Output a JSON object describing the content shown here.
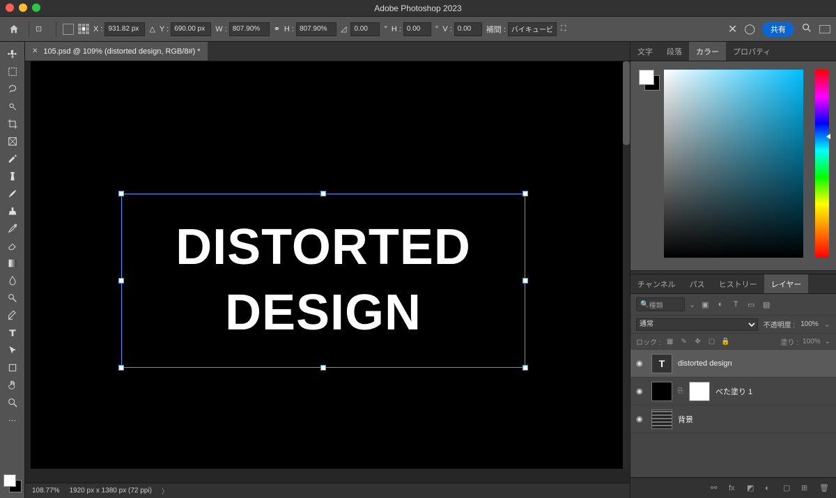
{
  "app_title": "Adobe Photoshop 2023",
  "options": {
    "x_label": "X :",
    "x_value": "931.82 px",
    "y_label": "Y :",
    "y_value": "690.00 px",
    "w_label": "W :",
    "w_value": "807.90%",
    "h_label": "H :",
    "h_value": "807.90%",
    "angle_label": "",
    "angle_value": "0.00",
    "hskew_label": "H :",
    "hskew_value": "0.00",
    "vskew_label": "V :",
    "vskew_value": "0.00",
    "interp_label": "補間 :",
    "interp_value": "バイキュービ…",
    "share": "共有"
  },
  "document": {
    "tab_title": "105.psd @ 109% (distorted design, RGB/8#) *",
    "canvas_text_line1": "DISTORTED",
    "canvas_text_line2": "DESIGN",
    "zoom": "108.77%",
    "dims": "1920 px x 1380 px (72 ppi)"
  },
  "panel1_tabs": {
    "t1": "文字",
    "t2": "段落",
    "t3": "カラー",
    "t4": "プロパティ"
  },
  "panel2_tabs": {
    "t1": "チャンネル",
    "t2": "パス",
    "t3": "ヒストリー",
    "t4": "レイヤー"
  },
  "layers": {
    "search_placeholder": "種類",
    "blend_mode": "通常",
    "opacity_label": "不透明度 :",
    "opacity_value": "100%",
    "lock_label": "ロック :",
    "fill_label": "塗り :",
    "fill_value": "100%",
    "items": [
      {
        "name": "distorted design",
        "type": "T"
      },
      {
        "name": "べた塗り 1",
        "type": "solid"
      },
      {
        "name": "背景",
        "type": "bg"
      }
    ]
  }
}
